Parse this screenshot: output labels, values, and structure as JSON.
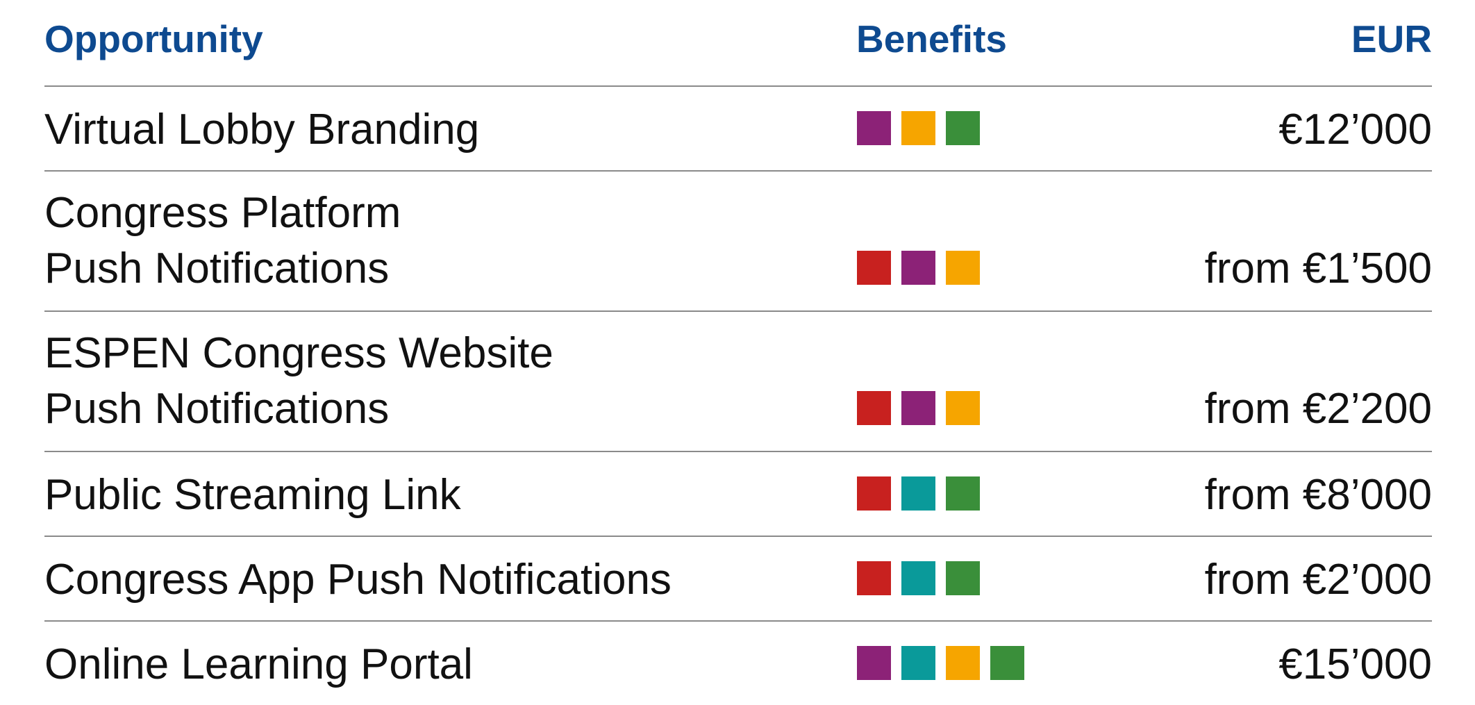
{
  "header": {
    "opportunity": "Opportunity",
    "benefits": "Benefits",
    "eur": "EUR"
  },
  "colors": {
    "header_text": "#0e4a90",
    "purple": "#8c2277",
    "orange": "#f6a500",
    "green": "#3a8f3a",
    "red": "#c8211f",
    "teal": "#0a9a9a",
    "rule": "#8a8a8a"
  },
  "rows": [
    {
      "lines": [
        "Virtual Lobby Branding"
      ],
      "benefits": [
        "purple",
        "orange",
        "green"
      ],
      "price": "€12’000"
    },
    {
      "lines": [
        "Congress Platform",
        "Push Notifications"
      ],
      "benefits": [
        "red",
        "purple",
        "orange"
      ],
      "price": "from €1’500"
    },
    {
      "lines": [
        "ESPEN Congress Website",
        "Push Notifications"
      ],
      "benefits": [
        "red",
        "purple",
        "orange"
      ],
      "price": "from €2’200"
    },
    {
      "lines": [
        "Public Streaming Link"
      ],
      "benefits": [
        "red",
        "teal",
        "green"
      ],
      "price": "from €8’000"
    },
    {
      "lines": [
        "Congress App Push Notifications"
      ],
      "benefits": [
        "red",
        "teal",
        "green"
      ],
      "price": "from €2’000"
    },
    {
      "lines": [
        "Online Learning Portal"
      ],
      "benefits": [
        "purple",
        "teal",
        "orange",
        "green"
      ],
      "price": "€15’000"
    }
  ]
}
